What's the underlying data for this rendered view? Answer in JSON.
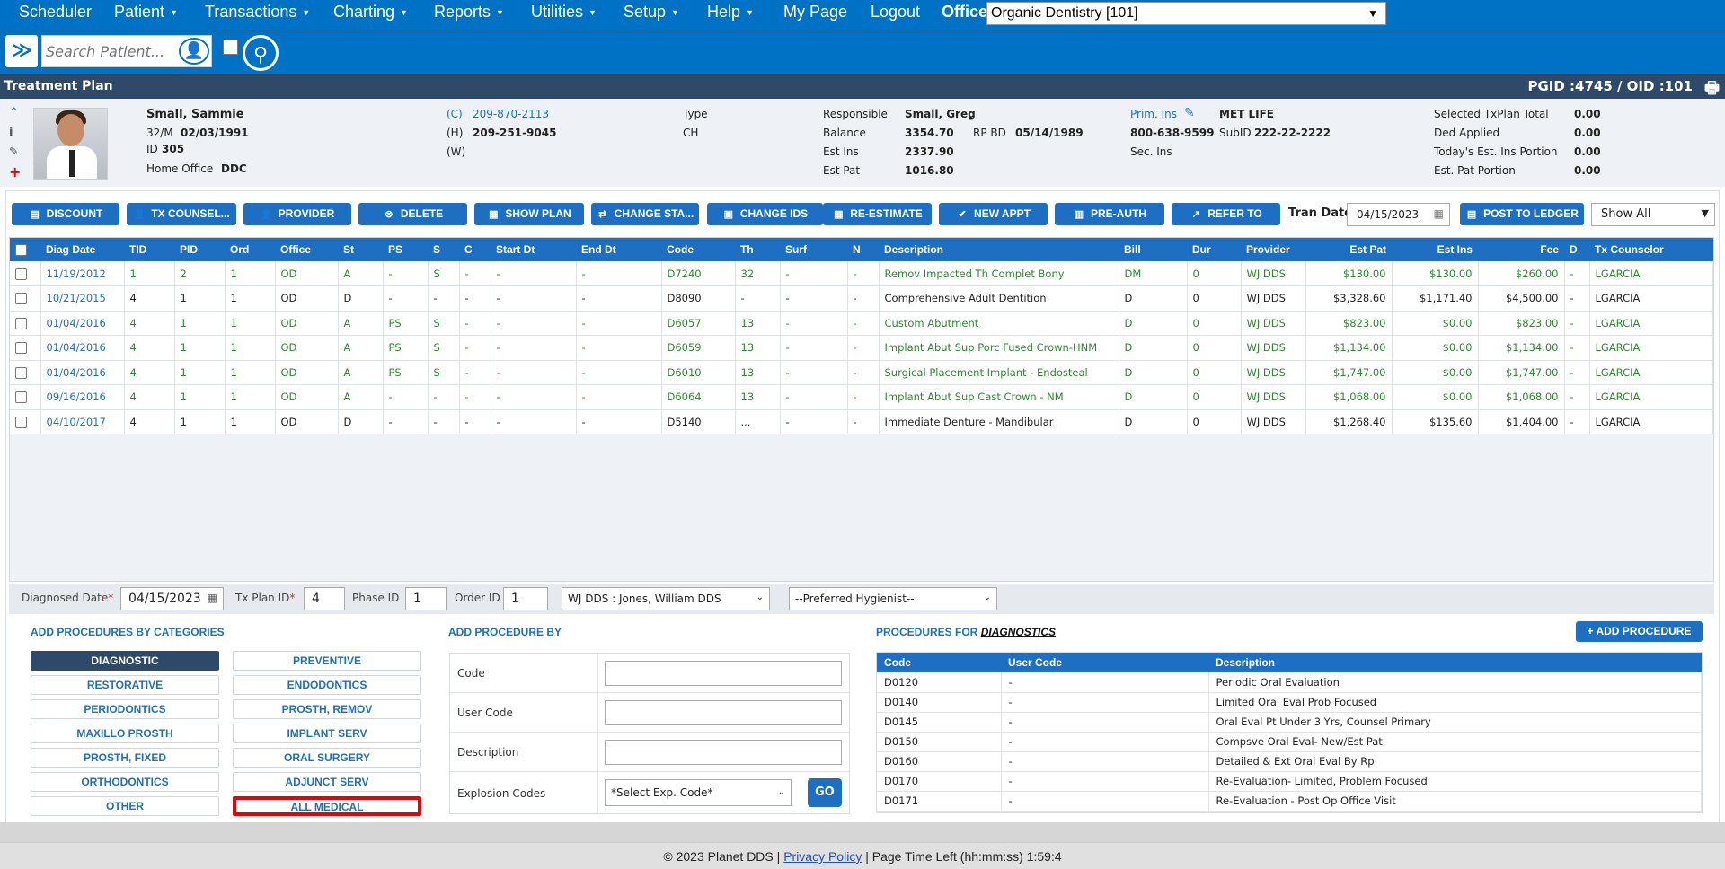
{
  "nav": {
    "items": [
      {
        "label": "Scheduler",
        "caret": false
      },
      {
        "label": "Patient",
        "caret": true
      },
      {
        "label": "Transactions",
        "caret": true
      },
      {
        "label": "Charting",
        "caret": true
      },
      {
        "label": "Reports",
        "caret": true
      },
      {
        "label": "Utilities",
        "caret": true
      },
      {
        "label": "Setup",
        "caret": true
      },
      {
        "label": "Help",
        "caret": true
      },
      {
        "label": "My Page",
        "caret": false
      },
      {
        "label": "Logout",
        "caret": false
      }
    ],
    "office_label": "Office",
    "office_value": "Organic Dentistry [101]"
  },
  "search": {
    "placeholder": "Search Patient..."
  },
  "title_bar": {
    "title": "Treatment Plan",
    "pgid": "PGID :4745 / OID :101"
  },
  "patient": {
    "name": "Small, Sammie",
    "age_sex": "32/M",
    "dob": "02/03/1991",
    "id_label": "ID",
    "id": "305",
    "home_office_label": "Home Office",
    "home_office": "DDC",
    "phone_c_label": "(C)",
    "phone_c": "209-870-2113",
    "phone_h_label": "(H)",
    "phone_h": "209-251-9045",
    "phone_w_label": "(W)",
    "type_label": "Type",
    "type": "CH",
    "responsible_label": "Responsible",
    "responsible": "Small, Greg",
    "balance_label": "Balance",
    "balance": "3354.70",
    "rp_bd_label": "RP BD",
    "rp_bd": "05/14/1989",
    "est_ins_label": "Est Ins",
    "est_ins": "2337.90",
    "est_pat_label": "Est Pat",
    "est_pat": "1016.80",
    "prim_ins_label": "Prim. Ins",
    "prim_ins": "MET LIFE",
    "prim_ins_phone": "800-638-9599",
    "subid_label": "SubID",
    "subid": "222-22-2222",
    "sec_ins_label": "Sec. Ins",
    "summary": [
      {
        "label": "Selected TxPlan Total",
        "value": "0.00"
      },
      {
        "label": "Ded Applied",
        "value": "0.00"
      },
      {
        "label": "Today's Est. Ins Portion",
        "value": "0.00"
      },
      {
        "label": "Est. Pat Portion",
        "value": "0.00"
      }
    ]
  },
  "actions": [
    {
      "label": "DISCOUNT",
      "icon": "document-icon"
    },
    {
      "label": "TX COUNSEL...",
      "icon": "user-icon"
    },
    {
      "label": "PROVIDER",
      "icon": "user-icon"
    },
    {
      "label": "DELETE",
      "icon": "close-icon"
    },
    {
      "label": "SHOW PLAN",
      "icon": "grid-icon"
    },
    {
      "label": "CHANGE STA...",
      "icon": "swap-icon"
    },
    {
      "label": "CHANGE IDS",
      "icon": "id-icon"
    },
    {
      "label": "RE-ESTIMATE",
      "icon": "calculator-icon"
    },
    {
      "label": "NEW APPT",
      "icon": "check-icon"
    },
    {
      "label": "PRE-AUTH",
      "icon": "calendar-icon"
    },
    {
      "label": "REFER TO",
      "icon": "share-icon"
    }
  ],
  "tran_date_label": "Tran Date",
  "tran_date": "04/15/2023",
  "post_to_ledger": "POST TO LEDGER",
  "show_all": "Show All",
  "grid": {
    "columns": [
      "Diag Date",
      "TID",
      "PID",
      "Ord",
      "Office",
      "St",
      "PS",
      "S",
      "C",
      "Start Dt",
      "End Dt",
      "Code",
      "Th",
      "Surf",
      "N",
      "Description",
      "Bill",
      "Dur",
      "Provider",
      "Est Pat",
      "Est Ins",
      "Fee",
      "D",
      "Tx Counselor"
    ],
    "rows": [
      {
        "style": "green",
        "cells": [
          "11/19/2012",
          "1",
          "2",
          "1",
          "OD",
          "A",
          "-",
          "S",
          "-",
          "-",
          "-",
          "D7240",
          "32",
          "-",
          "-",
          "Remov Impacted Th Complet Bony",
          "DM",
          "0",
          "WJ DDS",
          "$130.00",
          "$130.00",
          "$260.00",
          "-",
          "LGARCIA"
        ]
      },
      {
        "style": "black",
        "cells": [
          "10/21/2015",
          "4",
          "1",
          "1",
          "OD",
          "D",
          "-",
          "-",
          "-",
          "-",
          "-",
          "D8090",
          "-",
          "-",
          "-",
          "Comprehensive Adult Dentition",
          "D",
          "0",
          "WJ DDS",
          "$3,328.60",
          "$1,171.40",
          "$4,500.00",
          "-",
          "LGARCIA"
        ]
      },
      {
        "style": "green",
        "cells": [
          "01/04/2016",
          "4",
          "1",
          "1",
          "OD",
          "A",
          "PS",
          "S",
          "-",
          "-",
          "-",
          "D6057",
          "13",
          "-",
          "-",
          "Custom Abutment",
          "D",
          "0",
          "WJ DDS",
          "$823.00",
          "$0.00",
          "$823.00",
          "-",
          "LGARCIA"
        ]
      },
      {
        "style": "green",
        "cells": [
          "01/04/2016",
          "4",
          "1",
          "1",
          "OD",
          "A",
          "PS",
          "S",
          "-",
          "-",
          "-",
          "D6059",
          "13",
          "-",
          "-",
          "Implant Abut Sup Porc Fused Crown-HNM",
          "D",
          "0",
          "WJ DDS",
          "$1,134.00",
          "$0.00",
          "$1,134.00",
          "-",
          "LGARCIA"
        ]
      },
      {
        "style": "green",
        "cells": [
          "01/04/2016",
          "4",
          "1",
          "1",
          "OD",
          "A",
          "PS",
          "S",
          "-",
          "-",
          "-",
          "D6010",
          "13",
          "-",
          "-",
          "Surgical Placement Implant - Endosteal",
          "D",
          "0",
          "WJ DDS",
          "$1,747.00",
          "$0.00",
          "$1,747.00",
          "-",
          "LGARCIA"
        ]
      },
      {
        "style": "green",
        "cells": [
          "09/16/2016",
          "4",
          "1",
          "1",
          "OD",
          "A",
          "-",
          "-",
          "-",
          "-",
          "-",
          "D6064",
          "13",
          "-",
          "-",
          "Implant Abut Sup Cast Crown - NM",
          "D",
          "0",
          "WJ DDS",
          "$1,068.00",
          "$0.00",
          "$1,068.00",
          "-",
          "LGARCIA"
        ]
      },
      {
        "style": "black",
        "cells": [
          "04/10/2017",
          "4",
          "1",
          "1",
          "OD",
          "D",
          "-",
          "-",
          "-",
          "-",
          "-",
          "D5140",
          "...",
          "-",
          "-",
          "Immediate Denture - Mandibular",
          "D",
          "0",
          "WJ DDS",
          "$1,268.40",
          "$135.60",
          "$1,404.00",
          "-",
          "LGARCIA"
        ]
      }
    ]
  },
  "form": {
    "diag_date_label": "Diagnosed Date",
    "diag_date": "04/15/2023",
    "tx_plan_id_label": "Tx Plan ID",
    "tx_plan_id": "4",
    "phase_id_label": "Phase ID",
    "phase_id": "1",
    "order_id_label": "Order ID",
    "order_id": "1",
    "provider": "WJ DDS : Jones, William DDS",
    "hygienist": "--Preferred Hygienist--"
  },
  "categories": {
    "title": "ADD PROCEDURES BY CATEGORIES",
    "items": [
      "DIAGNOSTIC",
      "PREVENTIVE",
      "RESTORATIVE",
      "ENDODONTICS",
      "PERIODONTICS",
      "PROSTH, REMOV",
      "MAXILLO PROSTH",
      "IMPLANT SERV",
      "PROSTH, FIXED",
      "ORAL SURGERY",
      "ORTHODONTICS",
      "ADJUNCT SERV",
      "OTHER",
      "ALL MEDICAL"
    ],
    "active": "DIAGNOSTIC",
    "highlighted": "ALL MEDICAL"
  },
  "add_by": {
    "title": "ADD PROCEDURE BY",
    "code_label": "Code",
    "user_code_label": "User Code",
    "description_label": "Description",
    "explosion_label": "Explosion Codes",
    "explosion_select": "*Select Exp. Code*",
    "go": "GO"
  },
  "procedures": {
    "title_prefix": "PROCEDURES FOR",
    "title_category": "DIAGNOSTICS",
    "add_button": "ADD PROCEDURE",
    "columns": [
      "Code",
      "User Code",
      "Description"
    ],
    "rows": [
      [
        "D0120",
        "-",
        "Periodic Oral Evaluation"
      ],
      [
        "D0140",
        "-",
        "Limited Oral Eval Prob Focused"
      ],
      [
        "D0145",
        "-",
        "Oral Eval Pt Under 3 Yrs, Counsel Primary"
      ],
      [
        "D0150",
        "-",
        "Compsve Oral Eval- New/Est Pat"
      ],
      [
        "D0160",
        "-",
        "Detailed & Ext Oral Eval By Rp"
      ],
      [
        "D0170",
        "-",
        "Re-Evaluation- Limited, Problem Focused"
      ],
      [
        "D0171",
        "-",
        "Re-Evaluation - Post Op Office Visit"
      ]
    ]
  },
  "footer": {
    "copyright": "© 2023 Planet DDS |",
    "privacy": "Privacy Policy",
    "time_left": "| Page Time Left (hh:mm:ss) 1:59:4"
  }
}
